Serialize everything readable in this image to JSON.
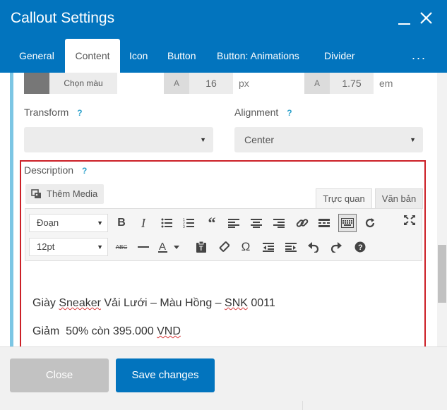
{
  "window": {
    "title": "Callout Settings",
    "minimize_icon": "minimize-icon",
    "close_icon": "close-icon"
  },
  "tabs": [
    {
      "label": "General",
      "active": false
    },
    {
      "label": "Content",
      "active": true
    },
    {
      "label": "Icon",
      "active": false
    },
    {
      "label": "Button",
      "active": false
    },
    {
      "label": "Button: Animations",
      "active": false
    },
    {
      "label": "Divider",
      "active": false
    }
  ],
  "tabs_more": "...",
  "style_row": {
    "color_button": "Chọn màu",
    "font_size_prefix": "A",
    "font_size_value": "16",
    "font_size_unit": "px",
    "line_height_prefix": "A",
    "line_height_value": "1.75",
    "line_height_unit": "em"
  },
  "transform": {
    "label": "Transform",
    "help": "?",
    "value": ""
  },
  "alignment": {
    "label": "Alignment",
    "help": "?",
    "value": "Center"
  },
  "description": {
    "label": "Description",
    "help": "?",
    "add_media": "Thêm Media",
    "tab_visual": "Trực quan",
    "tab_text": "Văn bản",
    "format_select": "Đoạn",
    "font_size_select": "12pt",
    "content_line1_parts": [
      "Giày ",
      "Sneaker",
      " Vải Lưới – Màu Hồng – ",
      "SNK",
      " 0011"
    ],
    "content_line2_parts": [
      "Giảm  50% còn 395.000 ",
      "VND"
    ]
  },
  "footer": {
    "close_label": "Close",
    "save_label": "Save changes"
  },
  "colors": {
    "header": "#0274be",
    "accent_bar": "#7cc6e4",
    "highlight_border": "#cc2027",
    "save_button": "#0274be",
    "close_button": "#c2c2c2"
  }
}
